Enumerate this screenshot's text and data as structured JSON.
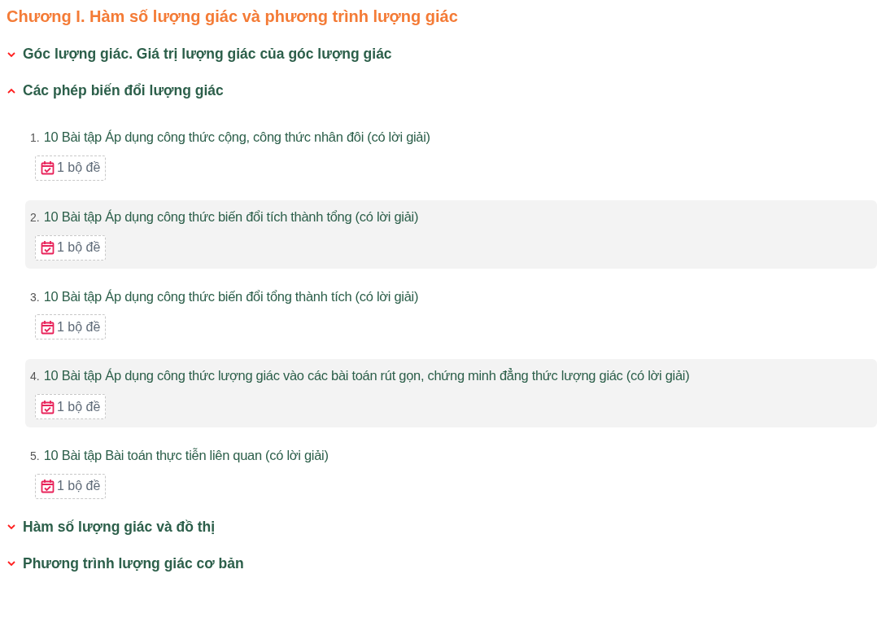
{
  "chapter_title": "Chương I. Hàm số lượng giác và phương trình lượng giác",
  "sections": [
    {
      "title": "Góc lượng giác. Giá trị lượng giác của góc lượng giác",
      "expanded": false
    },
    {
      "title": "Các phép biến đổi lượng giác",
      "expanded": true,
      "children": [
        {
          "number": "1.",
          "title": "10 Bài tập Áp dụng công thức cộng, công thức nhân đôi (có lời giải)",
          "badge": "1 bộ đề"
        },
        {
          "number": "2.",
          "title": "10 Bài tập Áp dụng công thức biến đổi tích thành tổng (có lời giải)",
          "badge": "1 bộ đề"
        },
        {
          "number": "3.",
          "title": "10 Bài tập Áp dụng công thức biến đổi tổng thành tích (có lời giải)",
          "badge": "1 bộ đề"
        },
        {
          "number": "4.",
          "title": "10 Bài tập Áp dụng công thức lượng giác vào các bài toán rút gọn, chứng minh đẳng thức lượng giác (có lời giải)",
          "badge": "1 bộ đề"
        },
        {
          "number": "5.",
          "title": "10 Bài tập Bài toán thực tiễn liên quan (có lời giải)",
          "badge": "1 bộ đề"
        }
      ]
    },
    {
      "title": "Hàm số lượng giác và đồ thị",
      "expanded": false
    },
    {
      "title": "Phương trình lượng giác cơ bản",
      "expanded": false
    }
  ]
}
